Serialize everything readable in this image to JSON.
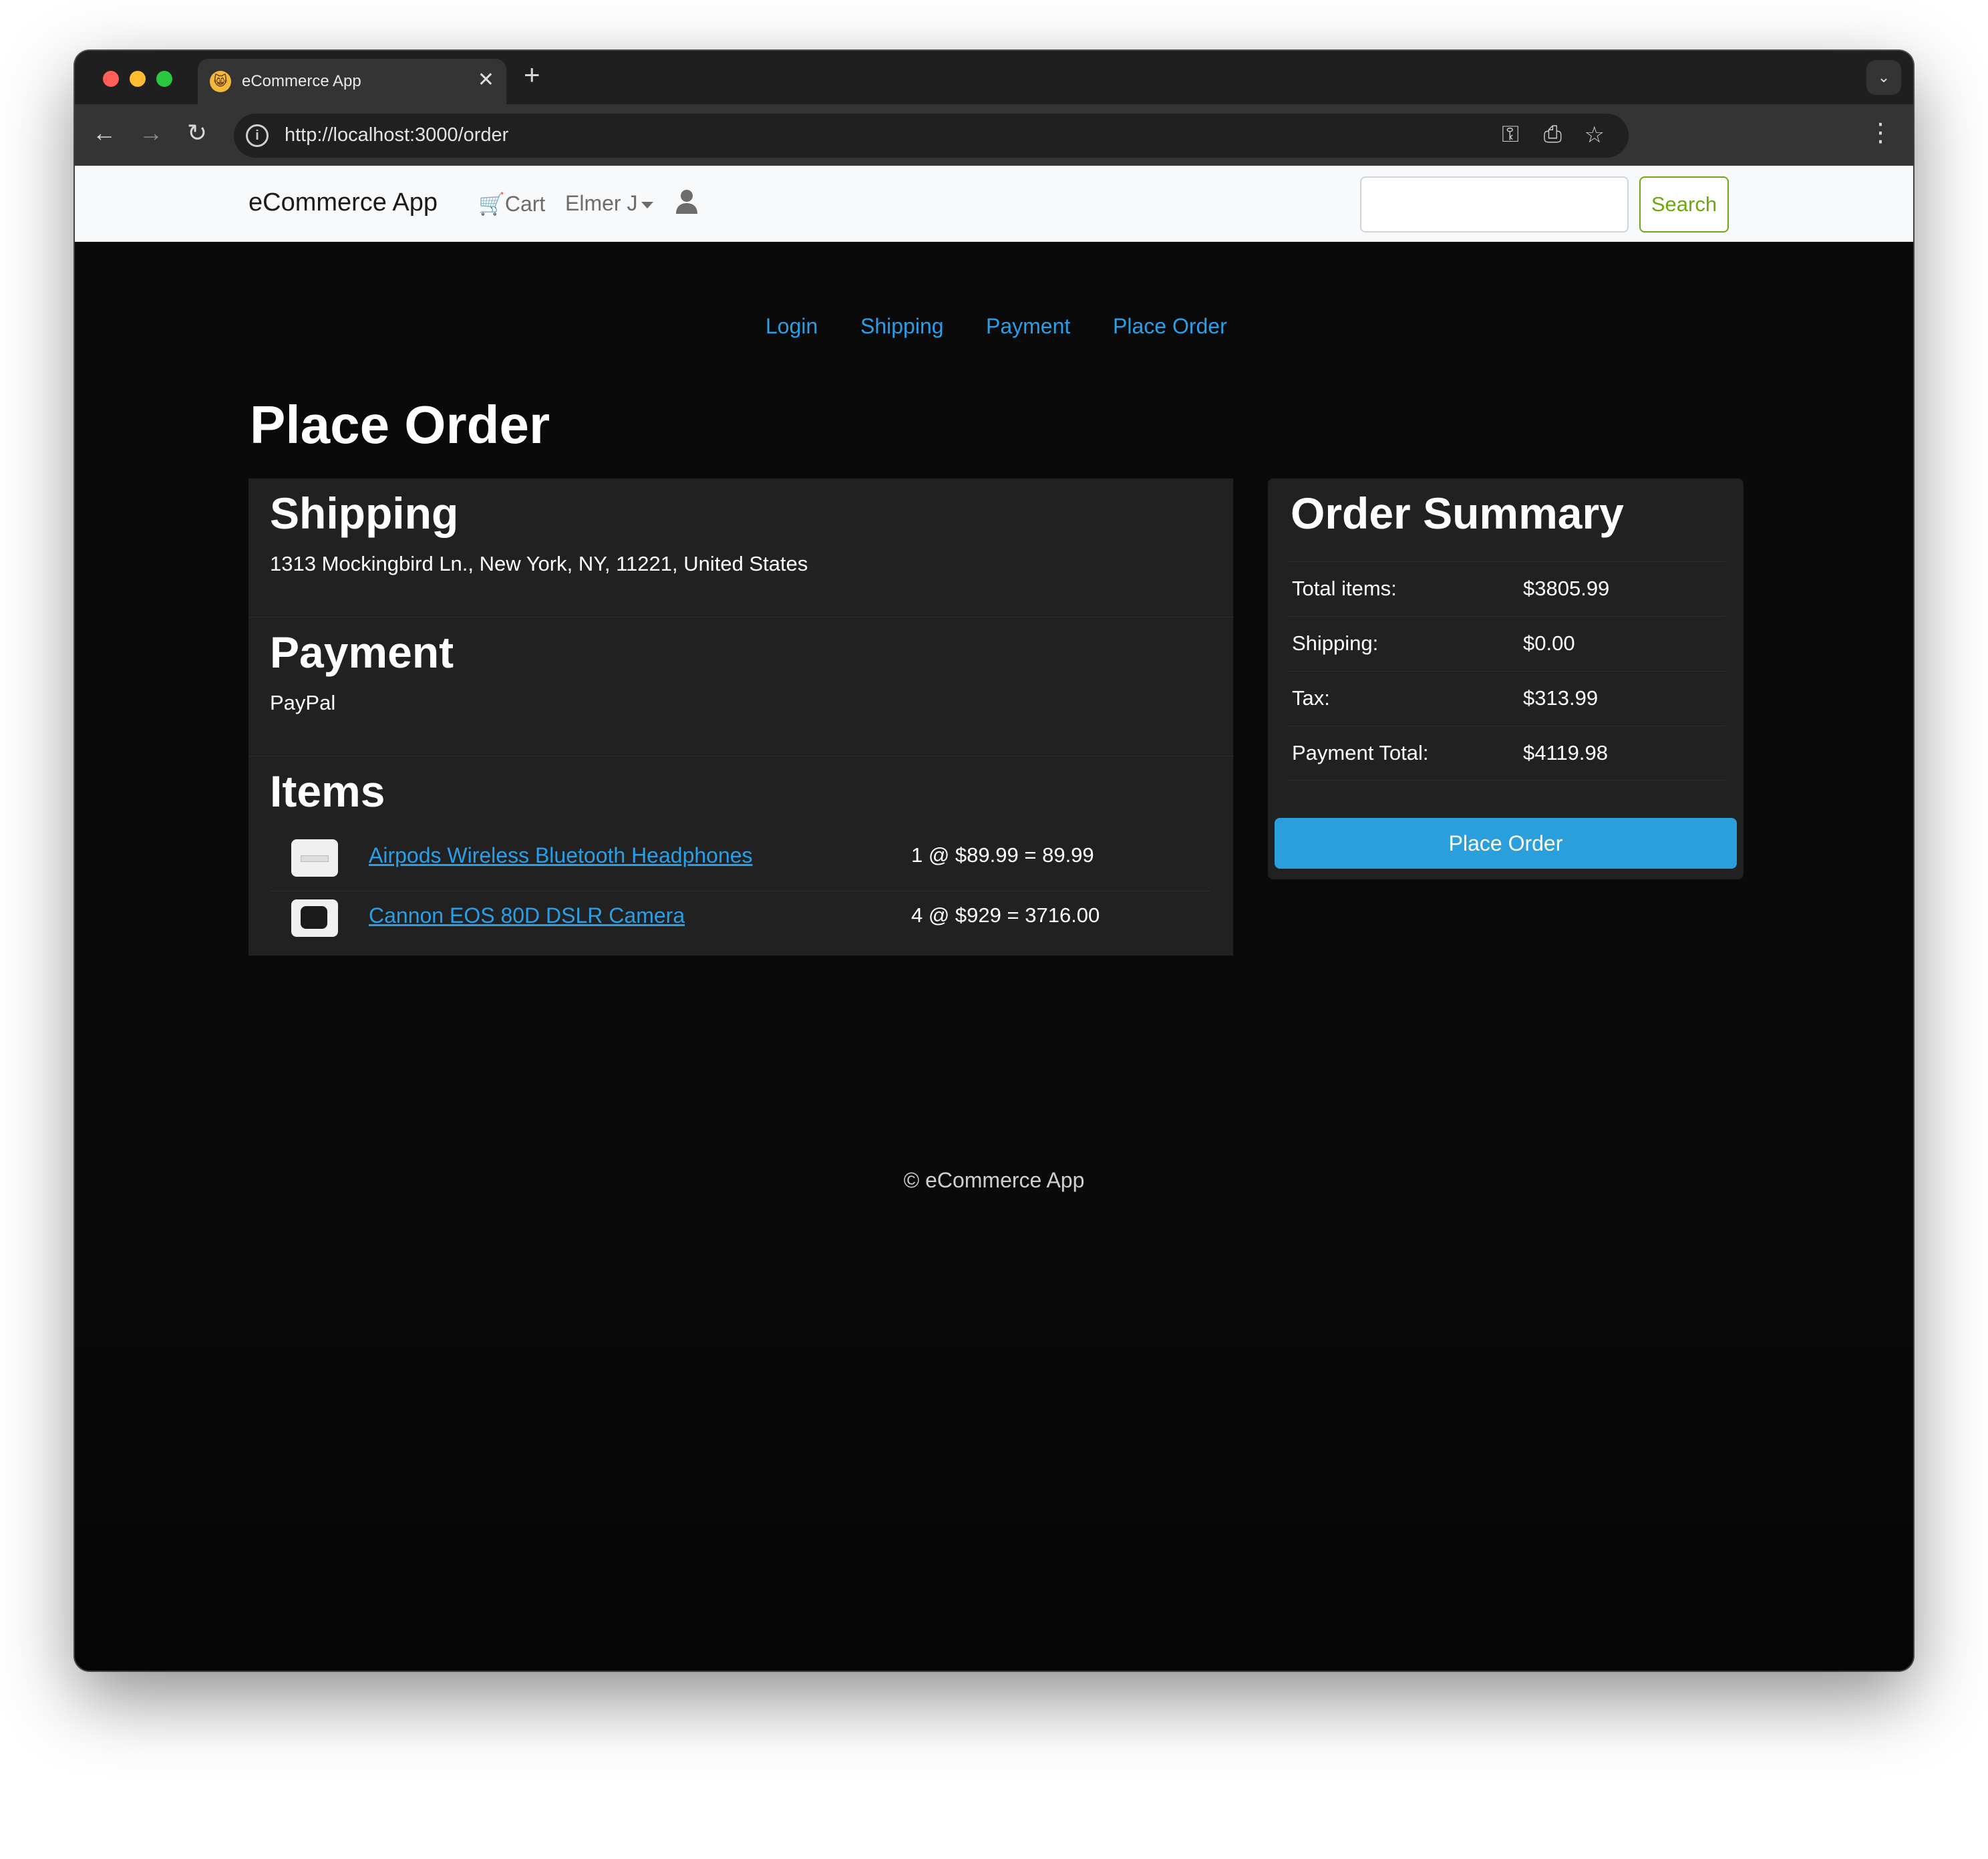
{
  "browser": {
    "tab_title": "eCommerce App",
    "tab_favicon": "😸",
    "url": "http://localhost:3000/order",
    "new_tab_label": "+",
    "close_label": "✕"
  },
  "navbar": {
    "brand": "eCommerce App",
    "cart_label": "Cart",
    "user_name": "Elmer J",
    "search_placeholder": "",
    "search_button": "Search"
  },
  "checkout_steps": [
    "Login",
    "Shipping",
    "Payment",
    "Place Order"
  ],
  "page_title": "Place Order",
  "shipping": {
    "heading": "Shipping",
    "address": "1313 Mockingbird Ln., New York, NY, 11221, United States"
  },
  "payment": {
    "heading": "Payment",
    "method": "PayPal"
  },
  "items": {
    "heading": "Items",
    "list": [
      {
        "name": "Airpods Wireless Bluetooth Headphones",
        "qty_price": "1 @ $89.99 = 89.99"
      },
      {
        "name": "Cannon EOS 80D DSLR Camera",
        "qty_price": "4 @ $929 = 3716.00"
      }
    ]
  },
  "summary": {
    "heading": "Order Summary",
    "rows": [
      {
        "label": "Total items:",
        "value": "$3805.99"
      },
      {
        "label": "Shipping:",
        "value": "$0.00"
      },
      {
        "label": "Tax:",
        "value": "$313.99"
      },
      {
        "label": "Payment Total:",
        "value": "$4119.98"
      }
    ],
    "button": "Place Order"
  },
  "footer": "© eCommerce App",
  "colors": {
    "accent": "#2a9ee6",
    "button": "#2a9fdb",
    "search_green": "#6ba90d",
    "page_bg": "#0a0a0a",
    "card_bg": "#212121"
  }
}
